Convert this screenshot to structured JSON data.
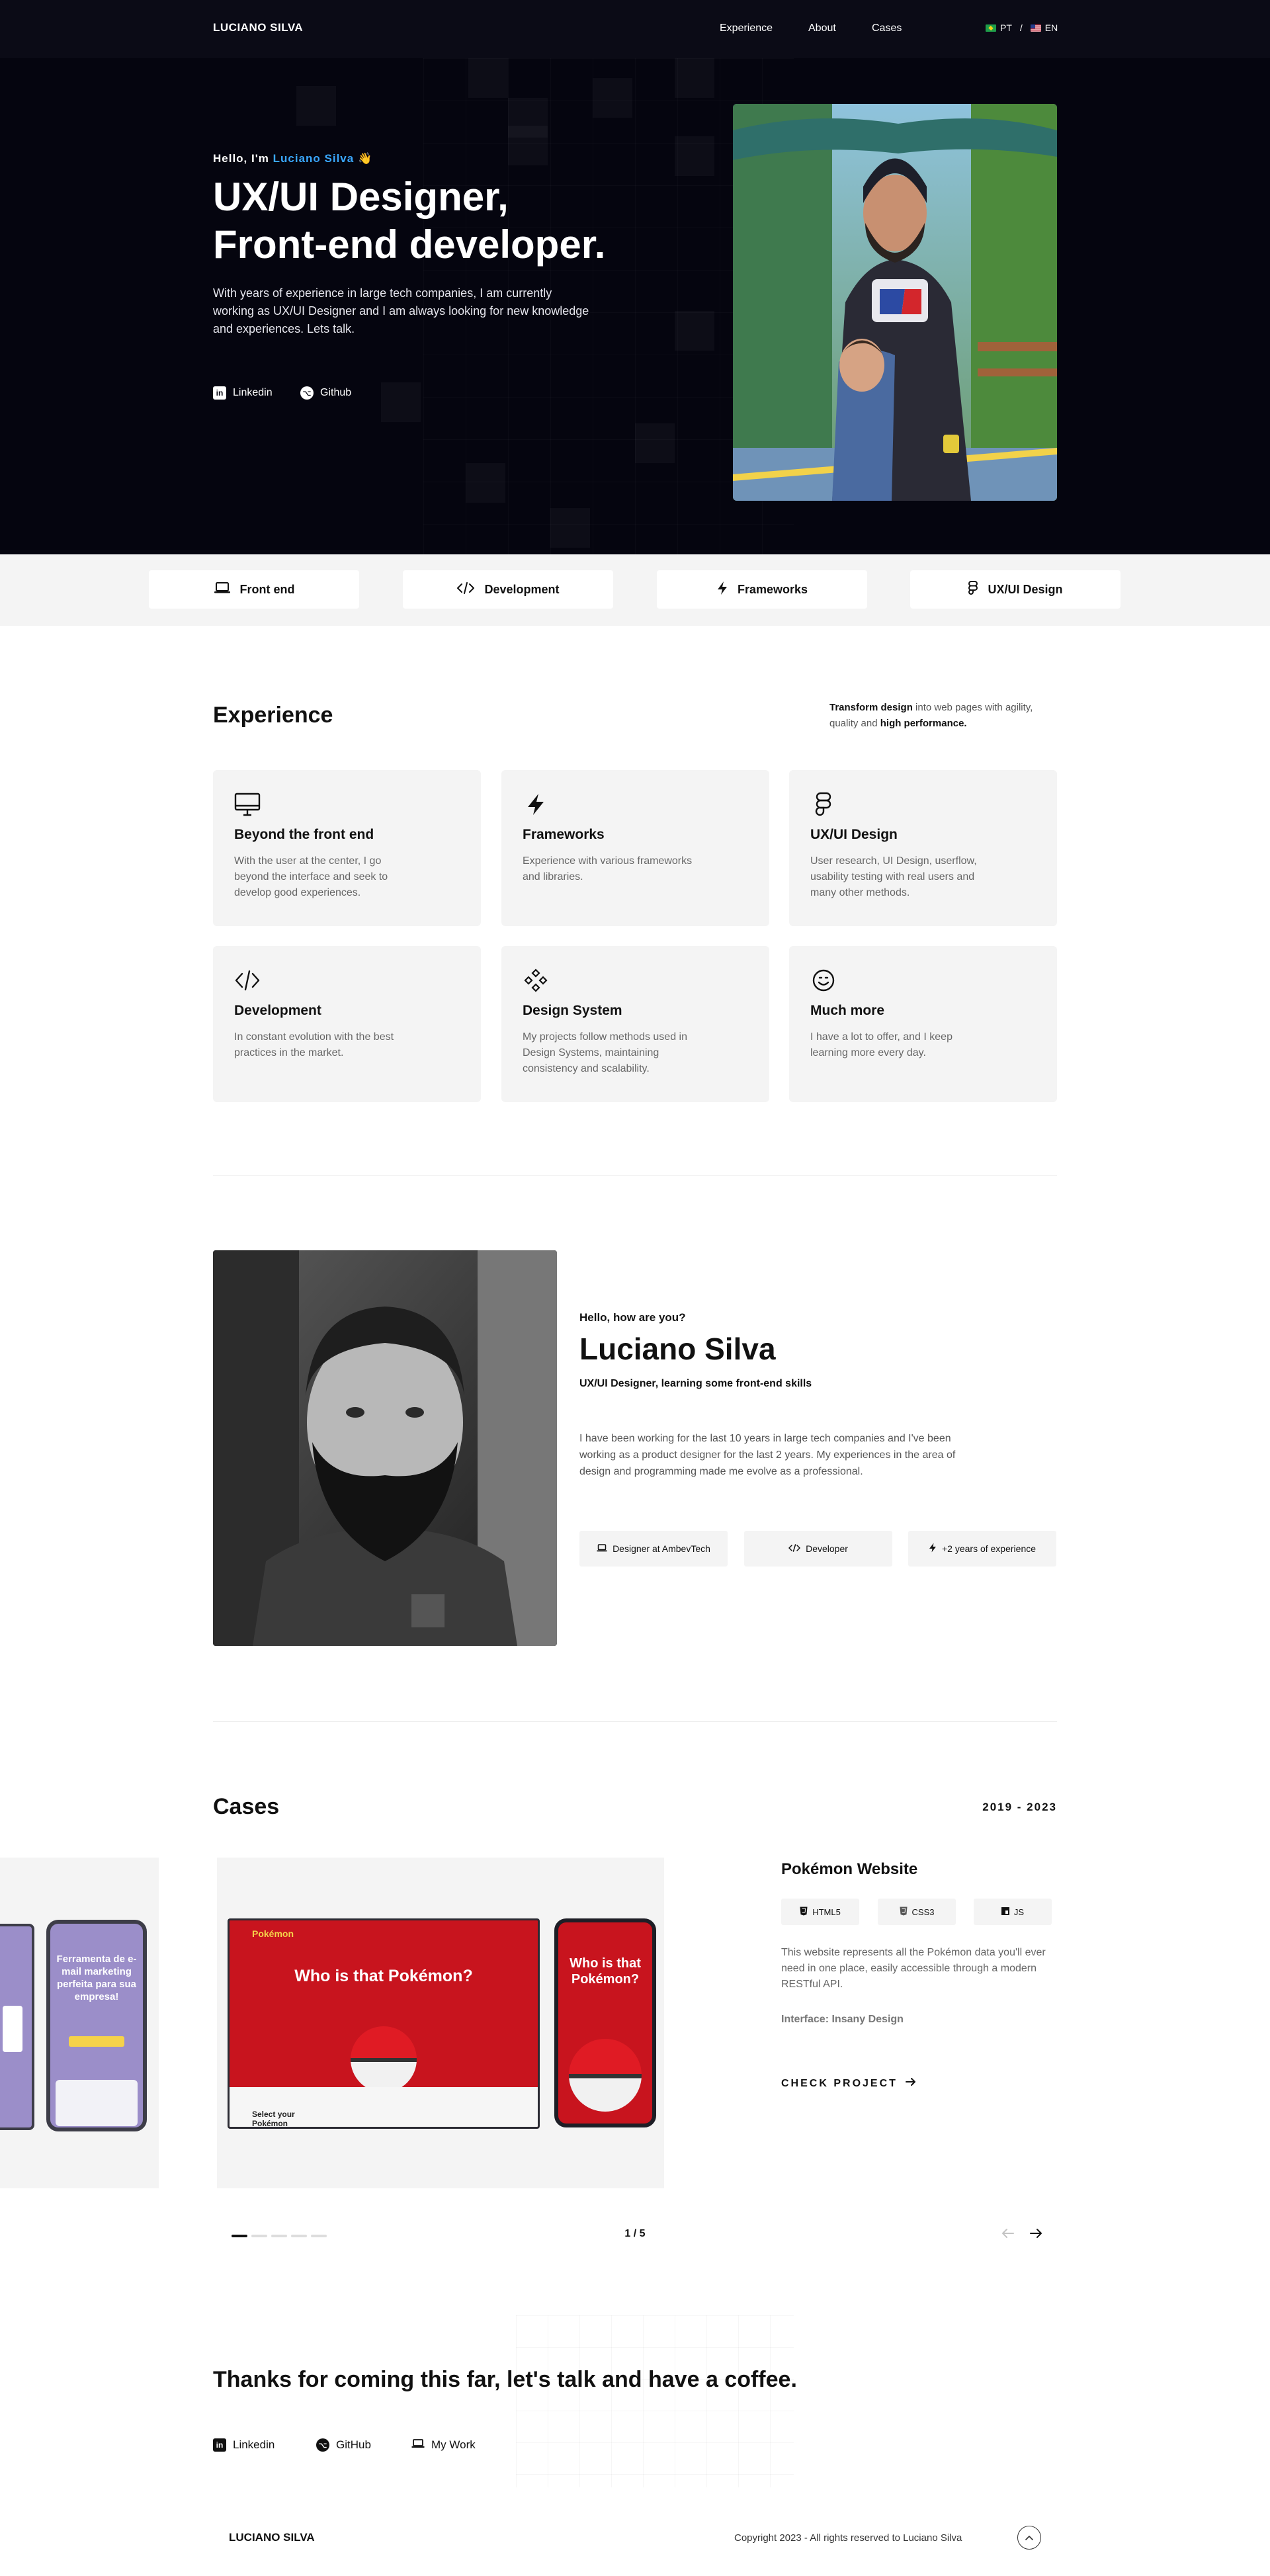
{
  "header": {
    "logo": "LUCIANO SILVA",
    "nav": [
      "Experience",
      "About",
      "Cases"
    ],
    "lang_pt": "PT",
    "lang_sep": "/",
    "lang_en": "EN"
  },
  "hero": {
    "greeting_prefix": "Hello, I'm",
    "greeting_name": "Luciano Silva",
    "greeting_emoji": "👋",
    "title_line1": "UX/UI Designer,",
    "title_line2": "Front-end developer.",
    "description": "With years of experience in large tech companies, I am currently working as UX/UI Designer and I am always looking for new knowledge and experiences. Lets talk.",
    "links": [
      {
        "label": "Linkedin",
        "icon": "linkedin-icon"
      },
      {
        "label": "Github",
        "icon": "github-icon"
      }
    ]
  },
  "skills": [
    {
      "label": "Front end",
      "icon": "laptop-icon"
    },
    {
      "label": "Development",
      "icon": "code-icon"
    },
    {
      "label": "Frameworks",
      "icon": "lightning-icon"
    },
    {
      "label": "UX/UI Design",
      "icon": "figma-icon"
    }
  ],
  "experience": {
    "title": "Experience",
    "tagline_bold1": "Transform design",
    "tagline_mid": " into web pages with agility, quality and ",
    "tagline_bold2": "high performance.",
    "cards": [
      {
        "title": "Beyond the front end",
        "desc": "With the user at the center, I go beyond the interface and seek to develop good experiences.",
        "icon": "monitor-icon"
      },
      {
        "title": "Frameworks",
        "desc": "Experience with various frameworks and libraries.",
        "icon": "lightning-icon"
      },
      {
        "title": "UX/UI Design",
        "desc": "User research, UI Design, userflow, usability testing with real users and many other methods.",
        "icon": "figma-icon"
      },
      {
        "title": "Development",
        "desc": "In constant evolution with the best practices in the market.",
        "icon": "code-icon"
      },
      {
        "title": "Design System",
        "desc": "My projects follow methods used in Design Systems, maintaining consistency and scalability.",
        "icon": "components-icon"
      },
      {
        "title": "Much more",
        "desc": "I have a lot to offer, and I keep learning more every day.",
        "icon": "smile-icon"
      }
    ]
  },
  "about": {
    "hello": "Hello, how are you?",
    "name": "Luciano Silva",
    "role": "UX/UI Designer, learning some front-end skills",
    "description": "I have been working for the last 10 years in large tech companies and I've been working as a product designer for the last 2 years. My experiences in the area of design and programming made me evolve as a professional.",
    "pills": [
      {
        "label": "Designer at AmbevTech",
        "icon": "laptop-icon"
      },
      {
        "label": "Developer",
        "icon": "code-icon"
      },
      {
        "label": "+2 years of experience",
        "icon": "lightning-icon"
      }
    ]
  },
  "cases": {
    "title": "Cases",
    "years": "2019 - 2023",
    "project_name": "Pokémon Website",
    "tech": [
      {
        "label": "HTML5",
        "icon": "html5-icon"
      },
      {
        "label": "CSS3",
        "icon": "css3-icon"
      },
      {
        "label": "JS",
        "icon": "js-icon"
      }
    ],
    "description": "This website represents all the Pokémon data you'll ever need in one place, easily accessible through a modern RESTful API.",
    "interface": "Interface: Insany Design",
    "cta": "CHECK PROJECT",
    "pager": "1 / 5",
    "slide_count": 5,
    "active_slide": 1,
    "mock_desktop_title": "Who is that Pokémon?",
    "mock_mobile_title": "Who is that Pokémon?",
    "mock_select": "Select your Pokémon",
    "mock_prev_title": "Ferramenta de e-mail marketing perfeita para sua empresa!"
  },
  "contact": {
    "title": "Thanks for coming this far, let's talk and have a coffee.",
    "links": [
      {
        "label": "Linkedin",
        "icon": "linkedin-icon"
      },
      {
        "label": "GitHub",
        "icon": "github-icon"
      },
      {
        "label": "My Work",
        "icon": "laptop-icon"
      }
    ]
  },
  "footer": {
    "logo": "LUCIANO SILVA",
    "copyright": "Copyright 2023 - All rights reserved to Luciano Silva"
  },
  "colors": {
    "hero_bg": "#05050f",
    "nav_bg": "#0b0b16",
    "accent": "#3aa8ff",
    "card_bg": "#f4f4f4",
    "pokemon_red": "#c8141e"
  }
}
